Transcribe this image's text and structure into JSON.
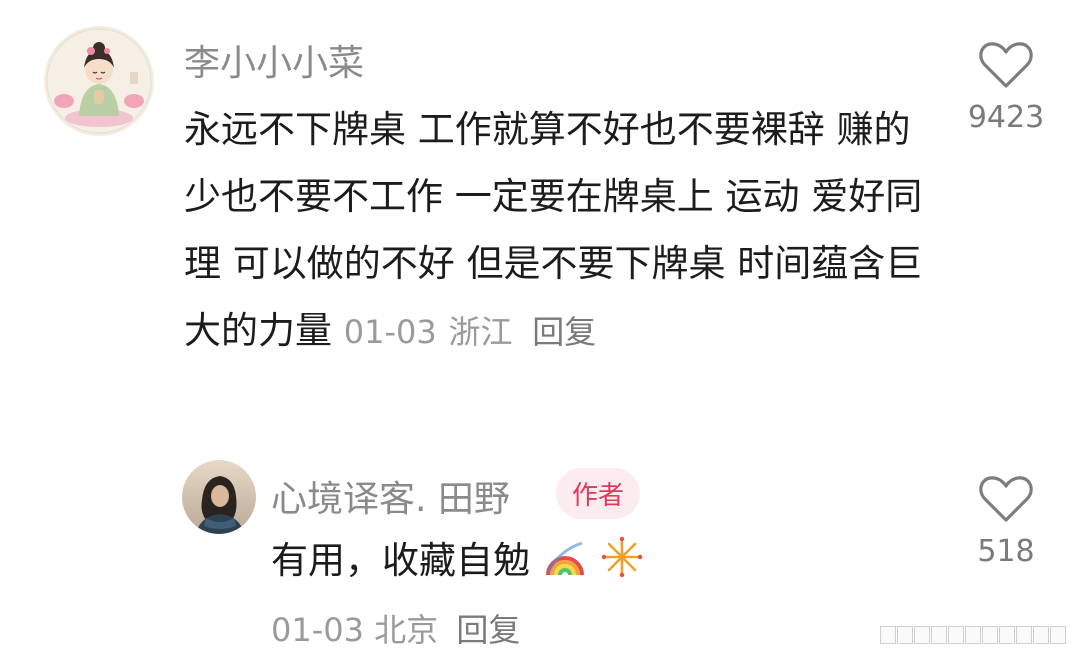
{
  "comment": {
    "username": "李小小小菜",
    "text": "永远不下牌桌 工作就算不好也不要裸辞 赚的少也不要不工作 一定要在牌桌上 运动 爱好同理 可以做的不好 但是不要下牌桌 时间蕴含巨大的力量",
    "date": "01-03",
    "location": "浙江",
    "reply_label": "回复",
    "like_count": "9423",
    "like_icon": "heart-outline-icon"
  },
  "reply": {
    "username": "心境译客. 田野",
    "badge": "作者",
    "text": "有用，收藏自勉",
    "emoji": [
      "rainbow-emoji",
      "fireworks-emoji"
    ],
    "date": "01-03",
    "location": "北京",
    "reply_label": "回复",
    "like_count": "518",
    "like_icon": "heart-outline-icon"
  },
  "colors": {
    "badge_bg": "#fdecef",
    "badge_text": "#e0395a",
    "muted": "#8a8a8a"
  }
}
